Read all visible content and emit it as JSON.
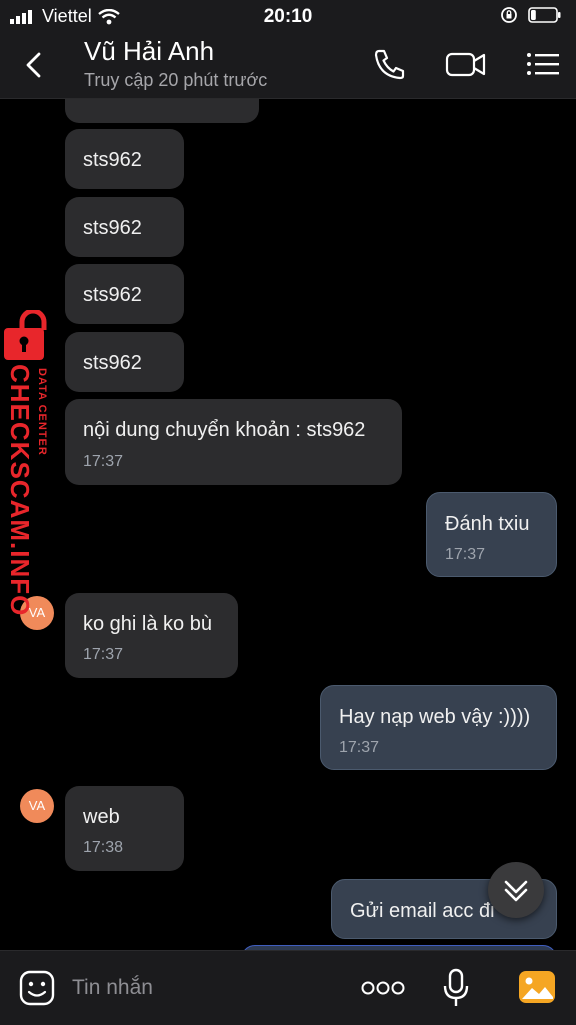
{
  "status_bar": {
    "carrier": "Viettel",
    "time": "20:10",
    "battery_level": 0.2
  },
  "header": {
    "name": "Vũ Hải Anh",
    "subtitle": "Truy cập 20 phút trước",
    "icons": [
      "back-chevron-icon",
      "phone-icon",
      "video-call-icon",
      "menu-icon"
    ]
  },
  "messages": [
    {
      "dir": "in",
      "text": "sts962"
    },
    {
      "dir": "in",
      "text": "sts962"
    },
    {
      "dir": "in",
      "text": "sts962"
    },
    {
      "dir": "in",
      "text": "sts962"
    },
    {
      "dir": "in",
      "text": "nội dung chuyển khoản : sts962",
      "time": "17:37"
    },
    {
      "dir": "out",
      "text": "Đánh txiu",
      "time": "17:37"
    },
    {
      "dir": "in",
      "avatar": "VA",
      "text": "ko ghi là ko bù",
      "time": "17:37"
    },
    {
      "dir": "out",
      "text": "Hay nạp web vậy :))))",
      "time": "17:37"
    },
    {
      "dir": "in",
      "avatar": "VA",
      "text": "web",
      "time": "17:38"
    },
    {
      "dir": "out",
      "text": "Gửi email acc đi"
    }
  ],
  "watermark": {
    "brand": "CHECKSCAM.INFO",
    "subtitle": "DATA CENTER"
  },
  "input": {
    "placeholder": "Tin nhắn",
    "icons": [
      "sticker-icon",
      "more-dots-icon",
      "microphone-icon",
      "gallery-icon"
    ]
  },
  "colors": {
    "background": "#000000",
    "incoming_bubble": "#2c2c2e",
    "outgoing_bubble": "#374150",
    "watermark_red": "#e8262b",
    "avatar": "#f08a5a"
  }
}
